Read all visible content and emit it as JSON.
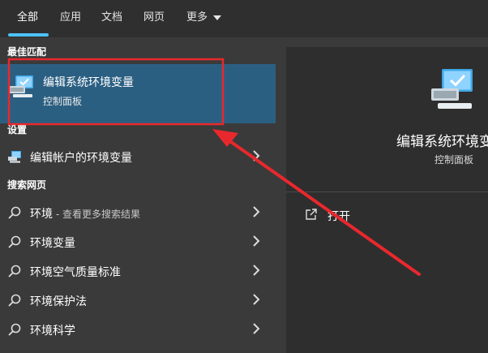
{
  "tabs": [
    {
      "label": "全部"
    },
    {
      "label": "应用"
    },
    {
      "label": "文档"
    },
    {
      "label": "网页"
    },
    {
      "label": "更多"
    }
  ],
  "sections": {
    "best_match": "最佳匹配",
    "settings": "设置",
    "web": "搜索网页"
  },
  "best_match": {
    "title": "编辑系统环境变量",
    "subtitle": "控制面板"
  },
  "settings_item": {
    "label": "编辑帐户的环境变量"
  },
  "web_results": [
    {
      "label": "环境",
      "suffix": " - 查看更多搜索结果"
    },
    {
      "label": "环境变量",
      "suffix": ""
    },
    {
      "label": "环境空气质量标准",
      "suffix": ""
    },
    {
      "label": "环境保护法",
      "suffix": ""
    },
    {
      "label": "环境科学",
      "suffix": ""
    }
  ],
  "preview": {
    "title": "编辑系统环境变量",
    "subtitle": "控制面板",
    "open_label": "打开"
  },
  "colors": {
    "accent": "#4cc2ff",
    "selection": "#2b5f82",
    "annotation": "#e8282d"
  }
}
